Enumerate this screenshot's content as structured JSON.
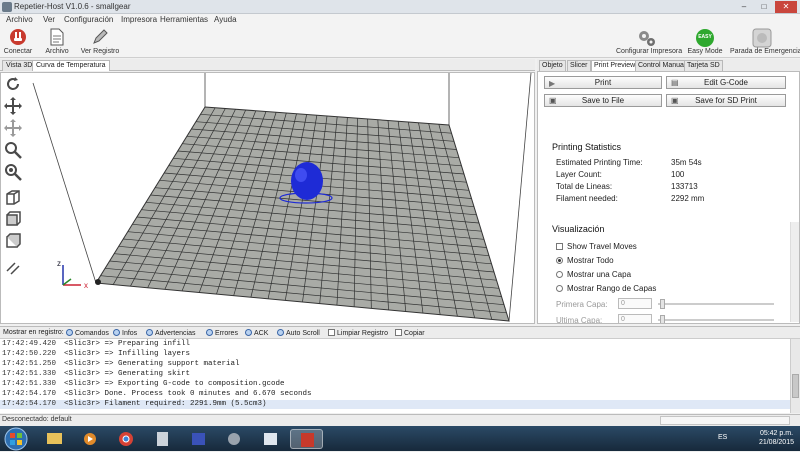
{
  "window": {
    "title": "Repetier-Host V1.0.6 - smallgear"
  },
  "menu": [
    "Archivo",
    "Ver",
    "Configuración",
    "Impresora",
    "Herramientas",
    "Ayuda"
  ],
  "toolbar": {
    "connect": "Conectar",
    "load": "Archivo",
    "log": "Ver Registro",
    "printer_settings": "Configurar Impresora",
    "easy_mode": "Easy Mode",
    "easy_mode_badge": "EASY",
    "emergency": "Parada de Emergencia"
  },
  "left_tabs": [
    "Vista 3D",
    "Curva de Temperatura"
  ],
  "right_tabs": [
    "Objeto",
    "Slicer",
    "Print Preview",
    "Control Manual",
    "Tarjeta SD"
  ],
  "buttons": {
    "print": "Print",
    "edit_gcode": "Edit G-Code",
    "save_file": "Save to File",
    "save_sd": "Save for SD Print"
  },
  "printing_statistics": {
    "title": "Printing Statistics",
    "rows": [
      {
        "label": "Estimated Printing Time:",
        "value": "35m 54s"
      },
      {
        "label": "Layer Count:",
        "value": "100"
      },
      {
        "label": "Total de Lineas:",
        "value": "133713"
      },
      {
        "label": "Filament needed:",
        "value": "2292 mm"
      }
    ]
  },
  "visualization": {
    "title": "Visualización",
    "show_travel": "Show Travel Moves",
    "show_all": "Mostrar Todo",
    "show_layer": "Mostrar una Capa",
    "show_range": "Mostrar Rango de Capas",
    "first_layer": "Primera Capa:",
    "first_layer_val": "0",
    "last_layer": "Ultima Capa:",
    "last_layer_val": "0"
  },
  "log_toolbar": {
    "label": "Mostrar en registro:",
    "items": [
      "Comandos",
      "Infos",
      "Advertencias",
      "Errores",
      "ACK",
      "Auto Scroll",
      "Limpiar Registro",
      "Copiar"
    ]
  },
  "log": [
    {
      "time": "17:42:49.420",
      "msg": "<Slic3r> => Preparing infill"
    },
    {
      "time": "17:42:50.220",
      "msg": "<Slic3r> => Infilling layers"
    },
    {
      "time": "17:42:51.250",
      "msg": "<Slic3r> => Generating support material"
    },
    {
      "time": "17:42:51.330",
      "msg": "<Slic3r> => Generating skirt"
    },
    {
      "time": "17:42:51.330",
      "msg": "<Slic3r> => Exporting G-code to composition.gcode"
    },
    {
      "time": "17:42:54.170",
      "msg": "<Slic3r> Done. Process took 0 minutes and 6.670 seconds"
    },
    {
      "time": "17:42:54.170",
      "msg": "<Slic3r> Filament required: 2291.9mm (5.5cm3)"
    }
  ],
  "status": "Desconectado: default",
  "axes": {
    "x": "x",
    "z": "z"
  },
  "clock": {
    "time": "05:42 p.m.",
    "date": "21/08/2015"
  },
  "lang": "ES",
  "colors": {
    "model": "#1e2bd6",
    "bed": "#a9aba6",
    "easy": "#2ea82e"
  }
}
